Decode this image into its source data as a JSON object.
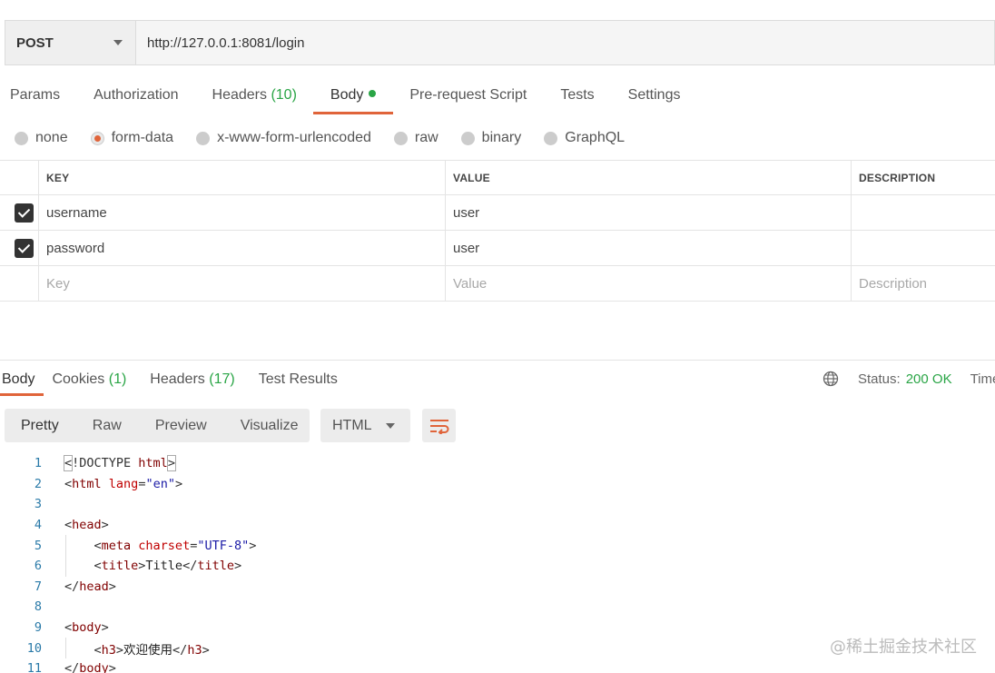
{
  "request": {
    "method": "POST",
    "url": "http://127.0.0.1:8081/login"
  },
  "request_tabs": [
    {
      "label": "Params"
    },
    {
      "label": "Authorization"
    },
    {
      "label": "Headers",
      "count": "(10)"
    },
    {
      "label": "Body",
      "active": true
    },
    {
      "label": "Pre-request Script"
    },
    {
      "label": "Tests"
    },
    {
      "label": "Settings"
    }
  ],
  "body_types": [
    "none",
    "form-data",
    "x-www-form-urlencoded",
    "raw",
    "binary",
    "GraphQL"
  ],
  "body_type_selected": "form-data",
  "form_table": {
    "headers": {
      "key": "KEY",
      "value": "VALUE",
      "description": "DESCRIPTION"
    },
    "rows": [
      {
        "key": "username",
        "value": "user",
        "checked": true
      },
      {
        "key": "password",
        "value": "user",
        "checked": true
      }
    ],
    "placeholders": {
      "key": "Key",
      "value": "Value",
      "description": "Description"
    }
  },
  "response_tabs": [
    {
      "label": "Body",
      "active": true
    },
    {
      "label": "Cookies",
      "count": "(1)"
    },
    {
      "label": "Headers",
      "count": "(17)"
    },
    {
      "label": "Test Results"
    }
  ],
  "status": {
    "label": "Status:",
    "value": "200 OK",
    "time_label": "Time:"
  },
  "view_modes": [
    "Pretty",
    "Raw",
    "Preview",
    "Visualize"
  ],
  "view_mode_active": "Pretty",
  "format": "HTML",
  "code_lines": [
    {
      "n": "1",
      "parts": [
        [
          "b",
          "<"
        ],
        [
          "t",
          "!DOCTYPE "
        ],
        [
          "tag",
          "html"
        ],
        [
          "b",
          ">"
        ]
      ]
    },
    {
      "n": "2",
      "parts": [
        [
          "t",
          "<"
        ],
        [
          "tag",
          "html"
        ],
        [
          "t",
          " "
        ],
        [
          "attr",
          "lang"
        ],
        [
          "t",
          "="
        ],
        [
          "str",
          "\"en\""
        ],
        [
          "t",
          ">"
        ]
      ]
    },
    {
      "n": "3",
      "parts": []
    },
    {
      "n": "4",
      "parts": [
        [
          "t",
          "<"
        ],
        [
          "tag",
          "head"
        ],
        [
          "t",
          ">"
        ]
      ]
    },
    {
      "n": "5",
      "indent": true,
      "parts": [
        [
          "t",
          "    <"
        ],
        [
          "tag",
          "meta"
        ],
        [
          "t",
          " "
        ],
        [
          "attr",
          "charset"
        ],
        [
          "t",
          "="
        ],
        [
          "str",
          "\"UTF-8\""
        ],
        [
          "t",
          ">"
        ]
      ]
    },
    {
      "n": "6",
      "indent": true,
      "parts": [
        [
          "t",
          "    <"
        ],
        [
          "tag",
          "title"
        ],
        [
          "t",
          ">"
        ],
        [
          "txt",
          "Title"
        ],
        [
          "t",
          "</"
        ],
        [
          "tag",
          "title"
        ],
        [
          "t",
          ">"
        ]
      ]
    },
    {
      "n": "7",
      "parts": [
        [
          "t",
          "</"
        ],
        [
          "tag",
          "head"
        ],
        [
          "t",
          ">"
        ]
      ]
    },
    {
      "n": "8",
      "parts": []
    },
    {
      "n": "9",
      "parts": [
        [
          "t",
          "<"
        ],
        [
          "tag",
          "body"
        ],
        [
          "t",
          ">"
        ]
      ]
    },
    {
      "n": "10",
      "indent": true,
      "parts": [
        [
          "t",
          "    <"
        ],
        [
          "tag",
          "h3"
        ],
        [
          "t",
          ">"
        ],
        [
          "txt",
          "欢迎使用"
        ],
        [
          "t",
          "</"
        ],
        [
          "tag",
          "h3"
        ],
        [
          "t",
          ">"
        ]
      ]
    },
    {
      "n": "11",
      "parts": [
        [
          "t",
          "</"
        ],
        [
          "tag",
          "body"
        ],
        [
          "t",
          ">"
        ]
      ]
    }
  ],
  "watermark": "@稀土掘金技术社区",
  "colors": {
    "accent": "#e0643a",
    "success": "#2aa546"
  }
}
